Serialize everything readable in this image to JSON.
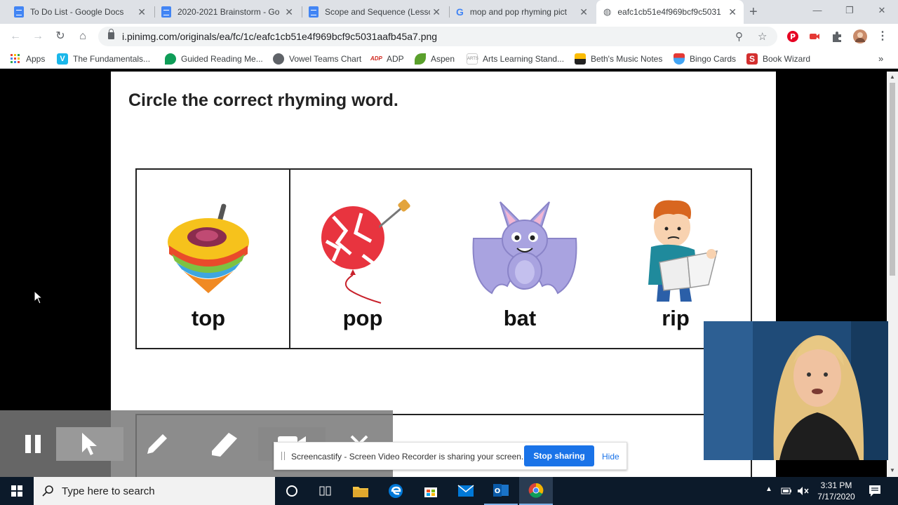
{
  "browser": {
    "tabs": [
      {
        "title": "To Do List - Google Docs",
        "icon": "docs-icon"
      },
      {
        "title": "2020-2021 Brainstorm - Go",
        "icon": "docs-icon"
      },
      {
        "title": "Scope and Sequence (Lesso",
        "icon": "docs-icon"
      },
      {
        "title": "mop and pop rhyming pict",
        "icon": "google-icon"
      },
      {
        "title": "eafc1cb51e4f969bcf9c5031",
        "icon": "globe-icon"
      }
    ],
    "url": "i.pinimg.com/originals/ea/fc/1c/eafc1cb51e4f969bcf9c5031aafb45a7.png",
    "bookmarks": [
      {
        "label": "Apps"
      },
      {
        "label": "The Fundamentals..."
      },
      {
        "label": "Guided Reading Me..."
      },
      {
        "label": "Vowel Teams Chart"
      },
      {
        "label": "ADP"
      },
      {
        "label": "Aspen"
      },
      {
        "label": "Arts Learning Stand..."
      },
      {
        "label": "Beth's Music Notes"
      },
      {
        "label": "Bingo Cards"
      },
      {
        "label": "Book Wizard"
      }
    ],
    "bookmarks_overflow": "»"
  },
  "worksheet": {
    "instruction": "Circle the correct rhyming word.",
    "words": [
      "top",
      "pop",
      "bat",
      "rip"
    ]
  },
  "share_notice": {
    "message": "Screencastify - Screen Video Recorder is sharing your screen.",
    "stop_label": "Stop sharing",
    "hide_label": "Hide"
  },
  "taskbar": {
    "search_placeholder": "Type here to search",
    "time": "3:31 PM",
    "date": "7/17/2020"
  },
  "colors": {
    "chrome_tabstrip": "#dee1e6",
    "accent_blue": "#1a73e8",
    "taskbar": "#0c1a2a"
  }
}
